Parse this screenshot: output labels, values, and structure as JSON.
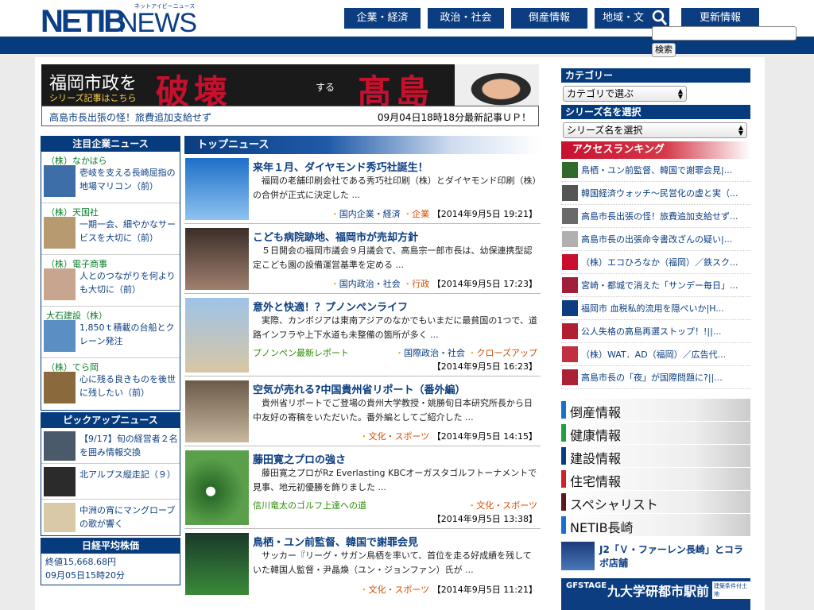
{
  "logo": {
    "kana": "ネットアイビーニュース"
  },
  "nav": [
    {
      "label": "企業・経済"
    },
    {
      "label": "政治・社会"
    },
    {
      "label": "倒産情報"
    },
    {
      "label": "地域・文"
    },
    {
      "label": "更新情報"
    }
  ],
  "search": {
    "button_label": "検索"
  },
  "banner": {
    "line1": "福岡市政を",
    "line2": "シリーズ記事はこちら",
    "headline_a": "破壊",
    "headline_mid": "する",
    "headline_b": "髙島",
    "sub_left": "高島市長出張の怪！旅費追加支給せず",
    "sub_right": "09月04日18時18分最新記事ＵＰ！"
  },
  "left": {
    "featured_title": "注目企業ニュース",
    "companies": [
      {
        "name": "（株）なかはら",
        "text": "壱岐を支える長崎屈指の地場マリコン（前）",
        "thumb": "#3d6ea8"
      },
      {
        "name": "（株）天国社",
        "text": "一期一会、細やかなサービスを大切に（前）",
        "thumb": "#b79a70"
      },
      {
        "name": "（株）電子商事",
        "text": "人とのつながりを何よりも大切に（前）",
        "thumb": "#c7a58e"
      },
      {
        "name": "大石建設（株）",
        "text": "1,850ｔ積載の台船とクレーン発注",
        "thumb": "#5b8fc4"
      },
      {
        "name": "（株）てら岡",
        "text": "心に残る良きものを後世に残したい（前）",
        "thumb": "#8a6a3c"
      }
    ],
    "pickup_title": "ピックアップニュース",
    "pickups": [
      {
        "text": "【9/17】旬の経営者２名を囲み情報交換",
        "thumb": "#4a5a6a"
      },
      {
        "text": "北アルプス縦走記（９）",
        "thumb": "#2b2b2b"
      },
      {
        "text": "中洲の宵にマングローブの歌が響く",
        "thumb": "#d9c9a8"
      }
    ],
    "nikkei_title": "日経平均株価",
    "nikkei_line1": "終値15,668.68円",
    "nikkei_line2": "09月05日15時20分"
  },
  "center": {
    "title": "トップニュース",
    "articles": [
      {
        "title": "来年１月、ダイヤモンド秀巧社誕生！",
        "body": "　福岡の老舗印刷会社である秀巧社印刷（株）とダイヤモンド印刷（株）の合併が正式に決定した ...",
        "series": "",
        "cat1": "国内企業・経済",
        "cat2": "企業",
        "date": "【2014年9月5日 19:21】",
        "thumb": "#3a86d4"
      },
      {
        "title": "こども病院跡地、福岡市が売却方針",
        "body": "　５日開会の福岡市議会９月議会で、高島宗一郎市長は、幼保連携型認定こども園の設備運営基準を定める ...",
        "series": "",
        "cat1": "国内政治・社会",
        "cat2": "行政",
        "date": "【2014年9月5日 17:23】",
        "thumb": "#5a4a40"
      },
      {
        "title": "意外と快適！？プノンペンライフ",
        "body": "　実際、カンボジアは東南アジアのなかでもいまだに最貧国の1つで、道路インフラや上下水道も未整備の箇所が多く ...",
        "series": "プノンペン最新レポート",
        "cat1": "国際政治・社会",
        "cat2": "クローズアップ",
        "date": "【2014年9月5日 16:23】",
        "thumb": "#c9b28f"
      },
      {
        "title": "空気が売れる?中国貴州省リポート（番外編）",
        "body": "　貴州省リポートでご登場の貴州大学教授・姚勝旬日本研究所長から日中友好の寄稿をいただいた。番外編としてご紹介した ...",
        "series": "",
        "cat1": "",
        "cat2": "文化・スポーツ",
        "date": "【2014年9月5日 14:15】",
        "thumb": "#8c7560"
      },
      {
        "title": "藤田寛之プロの強さ",
        "body": "　藤田寛之プロがRz Everlasting KBCオーガスタゴルフトーナメントで見事、地元初優勝を飾りました ...",
        "series": "信川竜太のゴルフ上達への道",
        "cat1": "",
        "cat2": "文化・スポーツ",
        "date": "【2014年9月5日 13:38】",
        "thumb": "#4f8a3a"
      },
      {
        "title": "鳥栖・ユン前監督、韓国で謝罪会見",
        "body": "　サッカー『リーグ・サガン鳥栖を率いて、首位を走る好成績を残していた韓国人監督・尹晶煥（ユン・ジョンファン）氏が ...",
        "series": "",
        "cat1": "",
        "cat2": "文化・スポーツ",
        "date": "【2014年9月5日 11:21】",
        "thumb": "#2f6b2a"
      }
    ]
  },
  "right": {
    "category_title": "カテゴリー",
    "category_select": "カテゴリで選ぶ",
    "series_title": "シリーズ名を選択",
    "series_select": "シリーズ名を選択",
    "ranking_title": "アクセスランキング",
    "ranking": [
      {
        "text": "鳥栖・ユン前監督、韓国で謝罪会見|...",
        "thumb": "#2f6b2a"
      },
      {
        "text": "韓国経済ウォッチ～民営化の虚と実（...",
        "thumb": "#555555"
      },
      {
        "text": "高島市長出張の怪！旅費追加支給せず...",
        "thumb": "#6a6a6a"
      },
      {
        "text": "高島市長の出張命令書改ざんの疑い|...",
        "thumb": "#b0b0b0"
      },
      {
        "text": "（株）エコひろなか（福岡）／鉄スク...",
        "thumb": "#c8102e"
      },
      {
        "text": "宮崎・都城で消えた「サンデー毎日」...",
        "thumb": "#a0203a"
      },
      {
        "text": "福岡市 血税私的流用を隠ぺいか|H...",
        "thumb": "#0b3d80"
      },
      {
        "text": "公人失格の高島再選ストップ！!||...",
        "thumb": "#b02030"
      },
      {
        "text": "（株）WAT．AD（福岡）／広告代...",
        "thumb": "#c03040"
      },
      {
        "text": "高島市長の「夜」が国際問題に?||...",
        "thumb": "#aa2233"
      }
    ],
    "categories": [
      {
        "label": "倒産情報",
        "color": "#1a6fd0"
      },
      {
        "label": "健康情報",
        "color": "#1fa03a"
      },
      {
        "label": "建設情報",
        "color": "#0b3d80"
      },
      {
        "label": "住宅情報",
        "color": "#d0202a"
      },
      {
        "label": "スペシャリスト",
        "color": "#5a1a1a"
      },
      {
        "label": "NETIB長崎",
        "color": "#1a6fd0"
      }
    ],
    "promo_text": "J2「Ｖ・ファーレン長崎」とコラボ店舗",
    "gf_a": "GFSTAGE",
    "gf_b": "九大学研都市駅前",
    "gf_c": "建築条件付土地"
  }
}
